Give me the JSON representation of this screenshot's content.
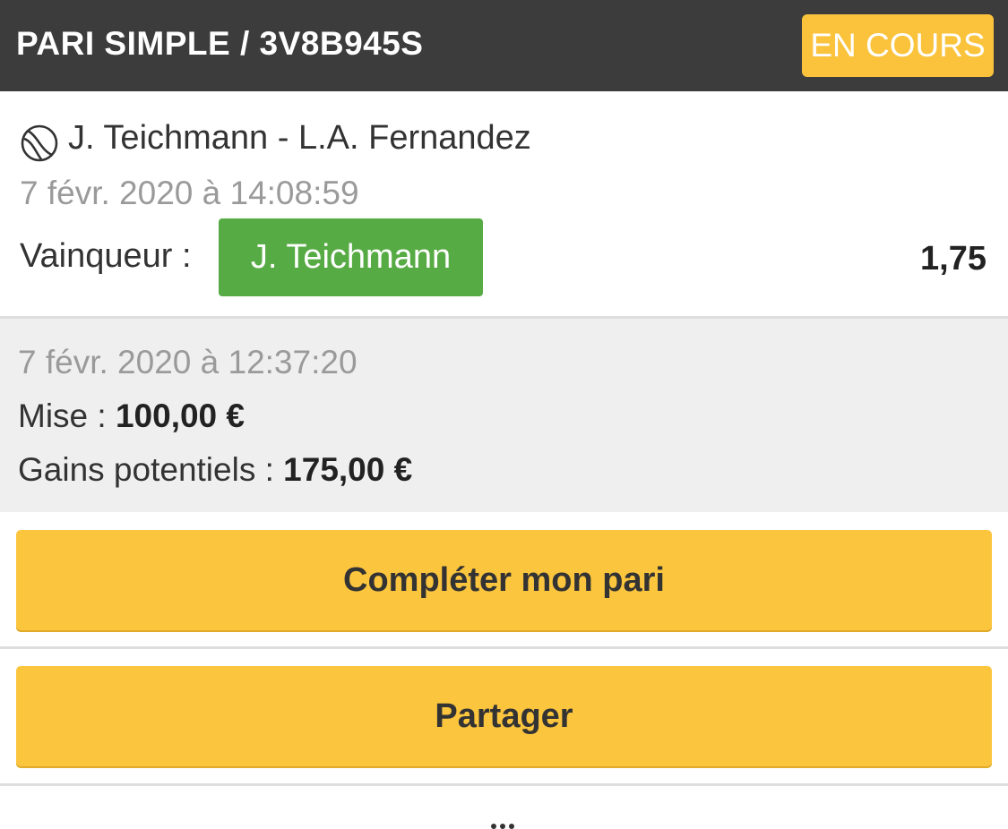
{
  "header": {
    "title": "PARI SIMPLE / 3V8B945S",
    "status": "EN COURS"
  },
  "event": {
    "sport_icon": "tennis-ball-icon",
    "match": "J. Teichmann - L.A. Fernandez",
    "date": "7 févr. 2020 à 14:08:59",
    "market_label": "Vainqueur :",
    "selection": "J. Teichmann",
    "odds": "1,75"
  },
  "summary": {
    "date": "7 févr. 2020 à 12:37:20",
    "stake_label": "Mise  :",
    "stake_value": "100,00 €",
    "winnings_label": "Gains potentiels  :",
    "winnings_value": "175,00 €"
  },
  "actions": {
    "complete_label": "Compléter mon pari",
    "share_label": "Partager",
    "more_icon": "more-dots-icon"
  },
  "colors": {
    "header_bg": "#3c3c3c",
    "accent_yellow": "#fbc33c",
    "selection_green": "#57ab44",
    "summary_bg": "#efefef"
  }
}
